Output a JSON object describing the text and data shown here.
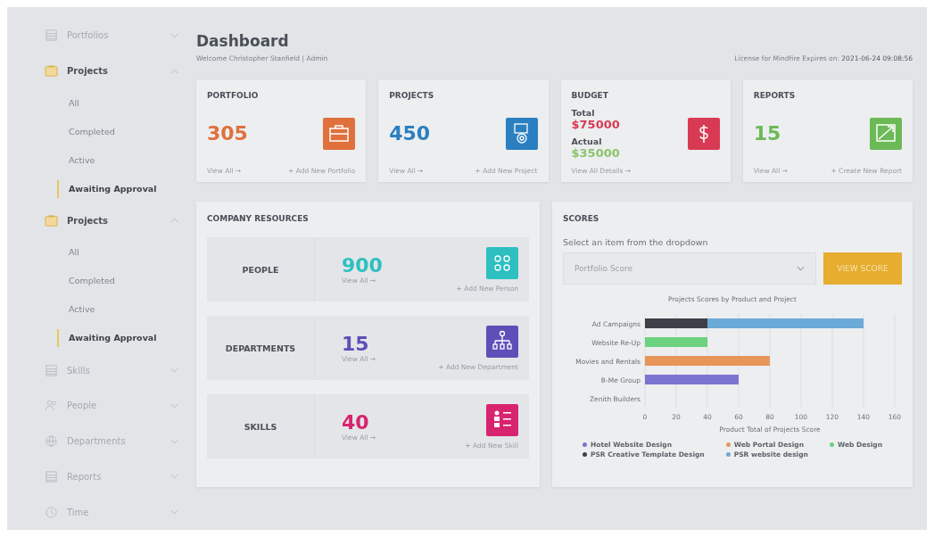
{
  "sidebar": {
    "items": [
      {
        "label": "Portfolios",
        "expanded": false
      },
      {
        "label": "Projects",
        "expanded": true,
        "children": [
          {
            "label": "All",
            "selected": false
          },
          {
            "label": "Completed",
            "selected": false
          },
          {
            "label": "Active",
            "selected": false
          },
          {
            "label": "Awaiting Approval",
            "selected": true
          }
        ]
      },
      {
        "label": "Projects",
        "expanded": true,
        "children": [
          {
            "label": "All",
            "selected": false
          },
          {
            "label": "Completed",
            "selected": false
          },
          {
            "label": "Active",
            "selected": false
          },
          {
            "label": "Awaiting Approval",
            "selected": true
          }
        ]
      },
      {
        "label": "Skills",
        "expanded": false
      },
      {
        "label": "People",
        "expanded": false
      },
      {
        "label": "Departments",
        "expanded": false
      },
      {
        "label": "Reports",
        "expanded": false
      },
      {
        "label": "Time",
        "expanded": false
      }
    ]
  },
  "header": {
    "title": "Dashboard",
    "subtitle": "Welcome Christopher Stanfield  |  Admin",
    "license": "License for Mindfire Expires on:",
    "license_date": "2021-06-24 09:08:56"
  },
  "stat_cards": [
    {
      "kind": "single",
      "title": "PORTFOLIO",
      "value": "305",
      "color": "#e0703c",
      "link": "View All →",
      "add": "+ Add New Portfolio"
    },
    {
      "kind": "single",
      "title": "PROJECTS",
      "value": "450",
      "color": "#2b7fc0",
      "link": "View All →",
      "add": "+ Add New Project"
    },
    {
      "kind": "budget",
      "title": "BUDGET",
      "total_label": "Total",
      "total": "$75000",
      "actual_label": "Actual",
      "actual": "$35000",
      "color": "#d83a53",
      "link": "View All Details →"
    },
    {
      "kind": "single",
      "title": "REPORTS",
      "value": "15",
      "color": "#6cb957",
      "link": "View All →",
      "add": "+ Create New Report"
    }
  ],
  "resources": {
    "title": "COMPANY RESOURCES",
    "rows": [
      {
        "label": "PEOPLE",
        "value": "900",
        "color": "#2ebfc0",
        "link": "View All →",
        "add": "+ Add New Person"
      },
      {
        "label": "DEPARTMENTS",
        "value": "15",
        "color": "#5e4fb8",
        "link": "View All →",
        "add": "+ Add New Department"
      },
      {
        "label": "SKILLS",
        "value": "40",
        "color": "#d8246e",
        "link": "View All →",
        "add": "+ Add New Skill"
      }
    ]
  },
  "scores": {
    "title": "SCORES",
    "prompt": "Select an item from the dropdown",
    "select_value": "Portfolio Score",
    "button": "VIEW SCORE",
    "chart_data": {
      "type": "bar",
      "orientation": "horizontal",
      "stacked": true,
      "title": "Projects Scores by Product and Project",
      "xlabel": "Product Total of Projects Score",
      "categories": [
        "Ad Campaigns",
        "Website Re-Up",
        "Movies and Rentals",
        "B-Me Group",
        "Zenith Builders"
      ],
      "xlim": [
        0,
        160
      ],
      "grid": true,
      "legend": true,
      "xticks": [
        0,
        20,
        40,
        60,
        80,
        100,
        120,
        140,
        160
      ],
      "series": [
        {
          "name": "Hotel Website Design",
          "color": "#7b74d1",
          "values": [
            null,
            null,
            null,
            60,
            null
          ]
        },
        {
          "name": "Web Portal Design",
          "color": "#e8955a",
          "values": [
            null,
            null,
            80,
            null,
            null
          ]
        },
        {
          "name": "Web Design",
          "color": "#6dd27f",
          "values": [
            null,
            40,
            null,
            null,
            null
          ]
        },
        {
          "name": "PSR Creative Template Design",
          "color": "#3f3f47",
          "values": [
            40,
            null,
            null,
            null,
            null
          ]
        },
        {
          "name": "PSR website design",
          "color": "#6aaad8",
          "values": [
            100,
            null,
            null,
            null,
            null
          ]
        }
      ]
    }
  }
}
